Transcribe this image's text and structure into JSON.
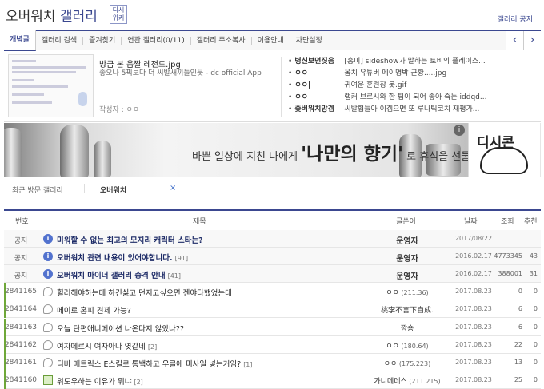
{
  "header": {
    "title_main": "오버워치",
    "title_sub": "갤러리",
    "badge": "디시\n위키",
    "public_link": "갤러리 공지"
  },
  "nav": {
    "items": [
      "개념글",
      "갤러리 검색",
      "즐겨찾기",
      "연관 갤러리(0/11)",
      "갤러리 주소복사",
      "이용안내",
      "차단설정"
    ],
    "prev_icon": "chevron-left-icon",
    "next_icon": "chevron-right-icon"
  },
  "featured": {
    "title": "방금 본 움짤 레전드.jpg",
    "desc": "좋오나 5픽보다 더 씨발새끼들인듯 - dc official App",
    "author_label": "작성자 :",
    "author": "ㅇㅇ",
    "list": [
      {
        "gallery": "병신보면짖음",
        "title": "[홍미] sideshow가 말하는 토비의 플레이스..."
      },
      {
        "gallery": "ㅇㅇ",
        "title": "옵치 유튜버 메이명박 근황.....jpg"
      },
      {
        "gallery": "ㅇㅇ|",
        "title": "귀여운 훈련장 봇.gif"
      },
      {
        "gallery": "ㅇㅇ",
        "title": "랭커 브르시와 한 팀이 되어 좋아 죽는 iddqd..."
      },
      {
        "gallery": "좆버워치망겜",
        "title": "씨발협들아 이겜으면 또 루나틱코치 재평가..."
      }
    ]
  },
  "banner": {
    "text_pre": "바쁜 일상에 지친 나에게",
    "text_big": "'나만의 향기'",
    "text_post": "로 휴식을 선물하세요!",
    "icon_label": "디시콘",
    "info_icon": "info-icon"
  },
  "recent": {
    "label": "최근 방문 갤러리",
    "gallery": "오버워치",
    "close": "×"
  },
  "table": {
    "headers": [
      "번호",
      "제목",
      "글쓴이",
      "날짜",
      "조회",
      "추천"
    ],
    "rows": [
      {
        "no": "공지",
        "icon": "info-icon",
        "title": "미워할 수 없는 최고의 모지리 캐릭터 스타는?",
        "count": "",
        "writer": "운영자",
        "ip": "",
        "date": "2017/08/22",
        "views": "",
        "rec": "",
        "notice": true
      },
      {
        "no": "공지",
        "icon": "info-icon",
        "title": "오버워치 관련 내용이 있어야합니다.",
        "count": "[91]",
        "writer": "운영자",
        "ip": "",
        "date": "2016.02.17",
        "views": "4773345",
        "rec": "43",
        "notice": true
      },
      {
        "no": "공지",
        "icon": "info-icon",
        "title": "오버워치 마이너 갤러리 승격 안내",
        "count": "[41]",
        "writer": "운영자",
        "ip": "",
        "date": "2016.02.17",
        "views": "388001",
        "rec": "31",
        "notice": true
      },
      {
        "no": "2841165",
        "icon": "speech-bubble-icon",
        "title": "힐러해야하는데 하긴싫고 던지고싶으면 젠야타했었는데",
        "count": "",
        "writer": "ㅇㅇ",
        "ip": "(211.36)",
        "date": "2017.08.23",
        "views": "0",
        "rec": "0",
        "notice": false
      },
      {
        "no": "2841164",
        "icon": "speech-bubble-icon",
        "title": "메이로 홈피 견제 가능?",
        "count": "",
        "writer": "桃李不言下自成.",
        "ip": "",
        "date": "2017.08.23",
        "views": "6",
        "rec": "0",
        "notice": false
      },
      {
        "no": "2841163",
        "icon": "speech-bubble-icon",
        "title": "오늘 단편애니메이션 나온다지 않았나??",
        "count": "",
        "writer": "깡숑",
        "ip": "",
        "date": "2017.08.23",
        "views": "6",
        "rec": "0",
        "notice": false
      },
      {
        "no": "2841162",
        "icon": "speech-bubble-icon",
        "title": "여자메르시 여자아나 엿같네",
        "count": "[2]",
        "writer": "ㅇㅇ",
        "ip": "(180.64)",
        "date": "2017.08.23",
        "views": "22",
        "rec": "0",
        "notice": false
      },
      {
        "no": "2841161",
        "icon": "speech-bubble-icon",
        "title": "디바 매트릭스 E스킬로 통백하고 우클에 미사일 넣는거임?",
        "count": "[1]",
        "writer": "ㅇㅇ",
        "ip": "(175.223)",
        "date": "2017.08.23",
        "views": "13",
        "rec": "0",
        "notice": false
      },
      {
        "no": "2841160",
        "icon": "image-icon",
        "title": "위도우하는 이유가 뭐냐",
        "count": "[2]",
        "writer": "가니메데스",
        "ip": "(211.215)",
        "date": "2017.08.23",
        "views": "25",
        "rec": "0",
        "notice": false
      }
    ]
  },
  "colors": {
    "brand": "#3b4890",
    "info": "#5272ce",
    "green": "#6fa839"
  }
}
